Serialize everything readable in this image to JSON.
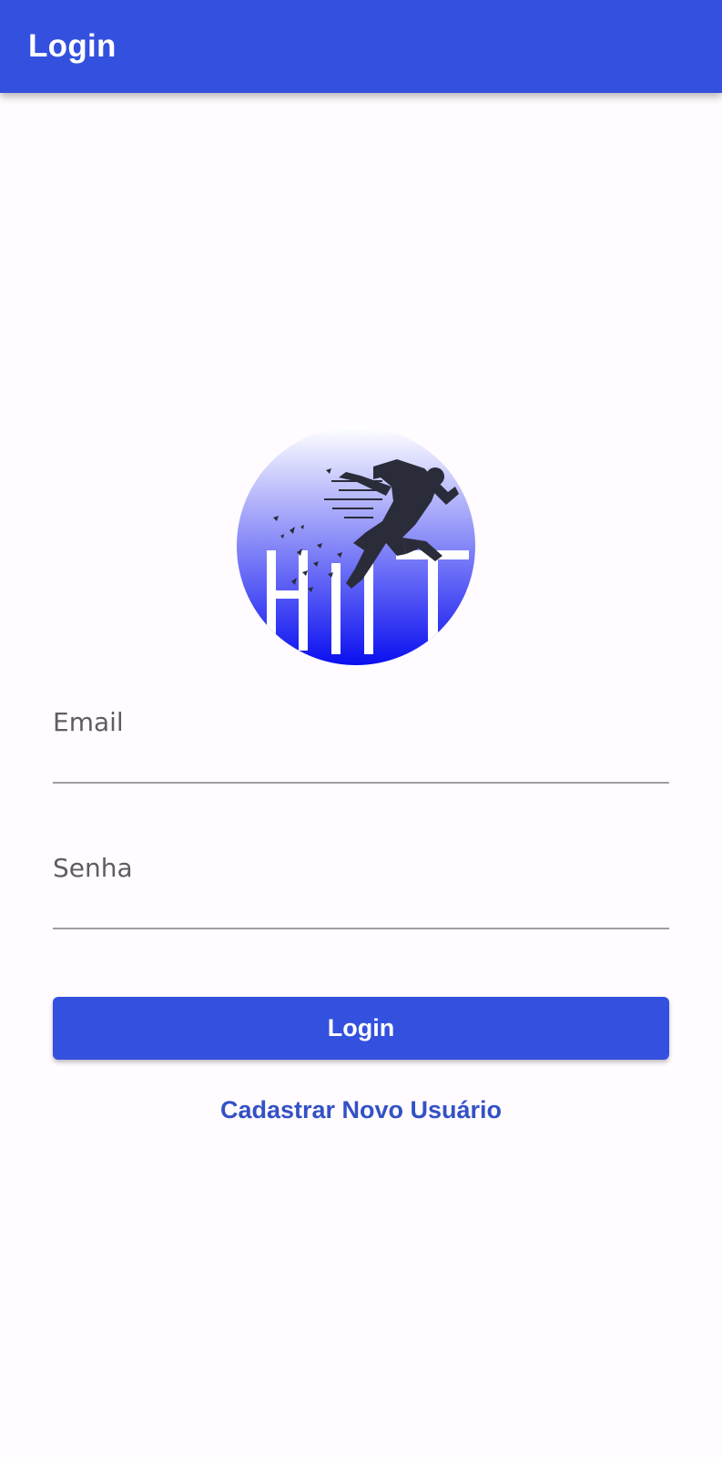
{
  "app_bar": {
    "title": "Login"
  },
  "logo": {
    "icon": "hiit-runner-logo",
    "text": "HIIT",
    "colors": {
      "gradient_top": "#ffffff",
      "gradient_bottom": "#0a0ff0",
      "runner": "#2a2c3a"
    }
  },
  "form": {
    "email": {
      "label": "Email",
      "value": ""
    },
    "senha": {
      "label": "Senha",
      "value": ""
    },
    "login_button": "Login",
    "register_link": "Cadastrar Novo Usuário"
  },
  "colors": {
    "primary": "#3351de",
    "background": "#fffbfe",
    "underline": "#a09da3",
    "label": "#5f5c63",
    "link": "#3351c6"
  }
}
